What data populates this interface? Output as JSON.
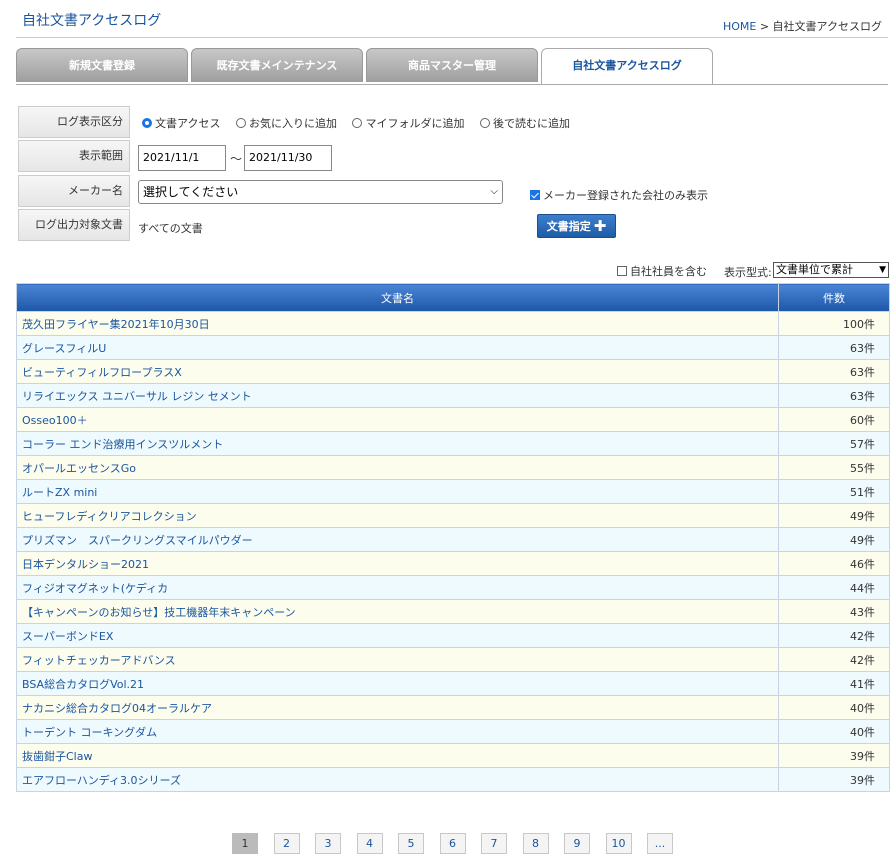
{
  "header": {
    "title": "自社文書アクセスログ",
    "breadcrumb_home": "HOME",
    "breadcrumb_sep": " > ",
    "breadcrumb_current": "自社文書アクセスログ"
  },
  "tabs": [
    {
      "label": "新規文書登録",
      "active": false
    },
    {
      "label": "既存文書メインテナンス",
      "active": false
    },
    {
      "label": "商品マスター管理",
      "active": false
    },
    {
      "label": "自社文書アクセスログ",
      "active": true
    }
  ],
  "form": {
    "log_type_label": "ログ表示区分",
    "log_type_options": [
      {
        "label": "文書アクセス",
        "selected": true
      },
      {
        "label": "お気に入りに追加",
        "selected": false
      },
      {
        "label": "マイフォルダに追加",
        "selected": false
      },
      {
        "label": "後で読むに追加",
        "selected": false
      }
    ],
    "range_label": "表示範囲",
    "range_from": "2021/11/1",
    "range_sep": "～",
    "range_to": "2021/11/30",
    "maker_label": "メーカー名",
    "maker_value": "選択してください",
    "maker_only_registered": "メーカー登録された会社のみ表示",
    "target_label": "ログ出力対象文書",
    "target_value": "すべての文書",
    "doc_button": "文書指定"
  },
  "options": {
    "include_staff": "自社社員を含む",
    "format_label": "表示型式:",
    "format_value": "文書単位で累計"
  },
  "table": {
    "headers": [
      "文書名",
      "件数"
    ],
    "rows": [
      {
        "name": "茂久田フライヤー集2021年10月30日",
        "count": "100件"
      },
      {
        "name": "グレースフィルU",
        "count": "63件"
      },
      {
        "name": "ビューティフィルフロープラスX",
        "count": "63件"
      },
      {
        "name": "リライエックス ユニバーサル レジン セメント",
        "count": "63件"
      },
      {
        "name": "Osseo100＋",
        "count": "60件"
      },
      {
        "name": "コーラー エンド治療用インスツルメント",
        "count": "57件"
      },
      {
        "name": "オパールエッセンスGo",
        "count": "55件"
      },
      {
        "name": "ルートZX mini",
        "count": "51件"
      },
      {
        "name": "ヒューフレディクリアコレクション",
        "count": "49件"
      },
      {
        "name": "プリズマン　スパークリングスマイルパウダー",
        "count": "49件"
      },
      {
        "name": "日本デンタルショー2021",
        "count": "46件"
      },
      {
        "name": "フィジオマグネット(ケディカ",
        "count": "44件"
      },
      {
        "name": "【キャンペーンのお知らせ】技工機器年末キャンペーン",
        "count": "43件"
      },
      {
        "name": "スーパーボンドEX",
        "count": "42件"
      },
      {
        "name": "フィットチェッカーアドバンス",
        "count": "42件"
      },
      {
        "name": "BSA総合カタログVol.21",
        "count": "41件"
      },
      {
        "name": "ナカニシ総合カタログ04オーラルケア",
        "count": "40件"
      },
      {
        "name": "トーデント コーキングダム",
        "count": "40件"
      },
      {
        "name": "抜歯鉗子Claw",
        "count": "39件"
      },
      {
        "name": "エアフローハンディ3.0シリーズ",
        "count": "39件"
      }
    ]
  },
  "pagination": {
    "pages": [
      "1",
      "2",
      "3",
      "4",
      "5",
      "6",
      "7",
      "8",
      "9",
      "10",
      "..."
    ],
    "current": "1"
  }
}
